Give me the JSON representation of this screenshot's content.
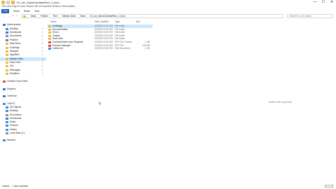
{
  "window": {
    "title": "01_run_NanoCarbaseRun_1 (run)",
    "controls": [
      "—",
      "☐",
      "✕"
    ],
    "info": "This view may be slow. Search will not examine all files in this location."
  },
  "ribbon": {
    "tabs": [
      "File",
      "Home",
      "Share",
      "View"
    ]
  },
  "address": {
    "crumbs": [
      "Data",
      "Folders",
      "Run",
      "Miratax Data",
      "Data",
      "01_run_NanoCarbaseRun_1 (run)"
    ],
    "search_placeholder": "Search 01_run_Nano..."
  },
  "sidebar": {
    "items": [
      {
        "label": "Quick access",
        "color": "#2a77d4"
      },
      {
        "label": "Desktop",
        "color": "#3b8bd8"
      },
      {
        "label": "Downloads",
        "color": "#2a77d4"
      },
      {
        "label": "Documents",
        "color": "#8a8a8a"
      },
      {
        "label": "Pictures",
        "color": "#3b8bd8"
      },
      {
        "label": "Data Runs",
        "color": "#e8b94a"
      },
      {
        "label": "Codelogs",
        "color": "#e8b94a"
      },
      {
        "label": "Wrapper",
        "color": "#e8b94a"
      },
      {
        "label": "Algorithm",
        "color": "#e8b94a"
      },
      {
        "label": "Miratax Data",
        "color": "#e8b94a",
        "selected": true
      },
      {
        "label": "Data Links",
        "color": "#e8b94a"
      },
      {
        "label": "Out",
        "color": "#e8b94a"
      },
      {
        "label": "Messages",
        "color": "#e8b94a"
      },
      {
        "label": "Workflow",
        "color": "#e8b94a"
      },
      {
        "label": "Creative Cloud Files",
        "color": "#d94b3a"
      },
      {
        "label": "Dropbox",
        "color": "#2a77d4"
      },
      {
        "label": "OneDrive",
        "color": "#2a77d4"
      },
      {
        "label": "This PC",
        "color": "#3b8bd8"
      },
      {
        "label": "3D Objects",
        "color": "#3b8bd8"
      },
      {
        "label": "Desktop",
        "color": "#3b8bd8"
      },
      {
        "label": "Documents",
        "color": "#8a8a8a"
      },
      {
        "label": "Downloads",
        "color": "#2a77d4"
      },
      {
        "label": "Music",
        "color": "#3b8bd8"
      },
      {
        "label": "Pictures",
        "color": "#3b8bd8"
      },
      {
        "label": "Videos",
        "color": "#3b8bd8"
      },
      {
        "label": "Local Disk (C:)",
        "color": "#8a8a8a"
      },
      {
        "label": "Network",
        "color": "#3b8bd8"
      }
    ]
  },
  "columns": [
    "Name",
    "Date modified",
    "Type",
    "Size"
  ],
  "files": [
    {
      "name": "Codelogs",
      "date": "3/2/2023 6:33 PM",
      "type": "File folder",
      "size": "",
      "color": "#e8b94a"
    },
    {
      "name": "Documentation",
      "date": "3/2/2023 6:33 PM",
      "type": "File folder",
      "size": "",
      "color": "#e8b94a"
    },
    {
      "name": "Errors",
      "date": "3/2/2023 6:33 PM",
      "type": "File folder",
      "size": "",
      "color": "#e8b94a"
    },
    {
      "name": "Graphs",
      "date": "3/2/2023 6:33 PM",
      "type": "File folder",
      "size": "",
      "color": "#e8b94a"
    },
    {
      "name": "Raw Data",
      "date": "3/2/2023 6:33 PM",
      "type": "File folder",
      "size": "",
      "color": "#e8b94a"
    },
    {
      "name": "CombineDeets from Template",
      "date": "3/2/2023 6:34 PM",
      "type": "PDF File Format",
      "size": "1 KB",
      "color": "#d94b3a"
    },
    {
      "name": "Process Manager",
      "date": "3/2/2023 6:34 PM",
      "type": "PDF File",
      "size": "145 KB",
      "color": "#d94b3a"
    },
    {
      "name": "Outline.txt",
      "date": "3/2/2023 6:35 PM",
      "type": "Text Document",
      "size": "1 KB",
      "color": "#3b8bd8"
    }
  ],
  "details_pane": "Select a file to preview.",
  "status": {
    "count": "8 items",
    "selected": "1 item selected"
  }
}
